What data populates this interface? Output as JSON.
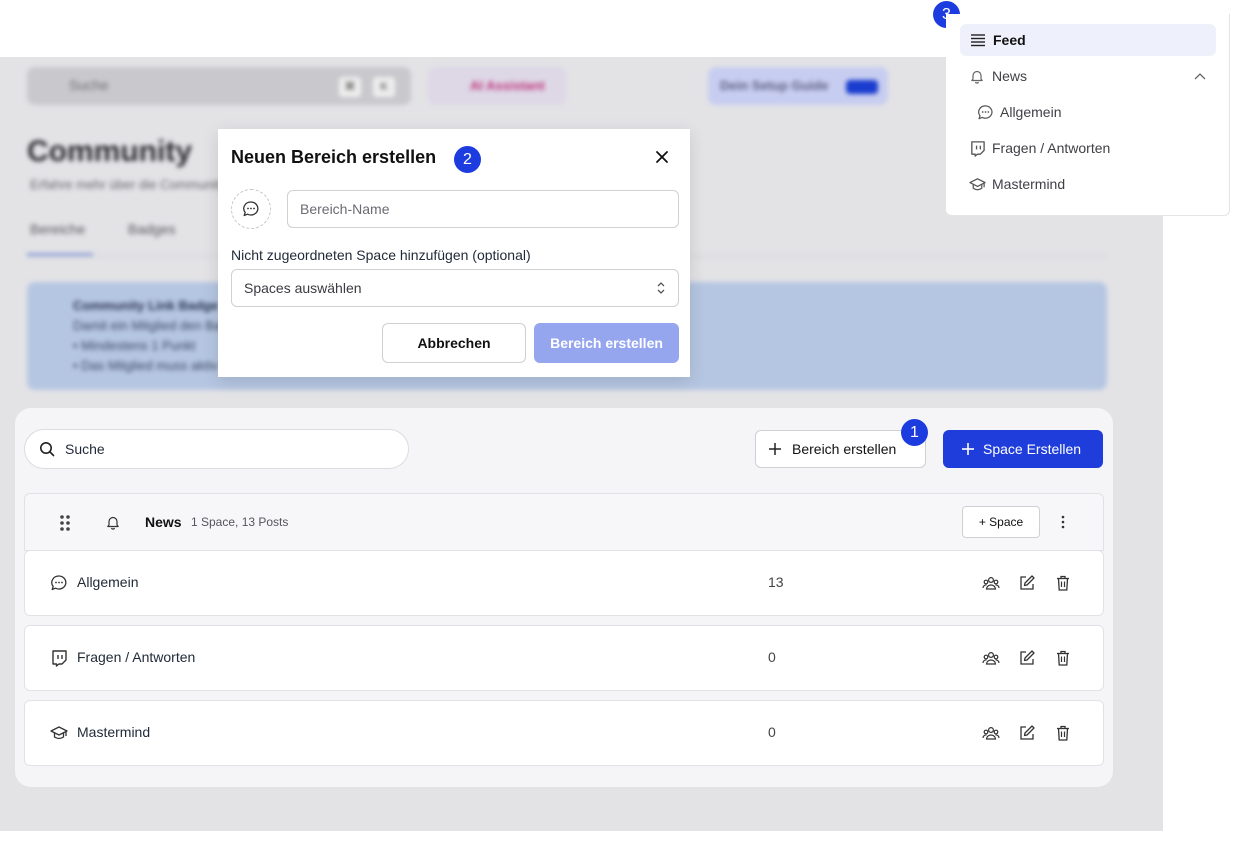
{
  "background": {
    "search_placeholder": "Suche",
    "shortcut_keys": [
      "⌘",
      "K"
    ],
    "ai_assistant_label": "AI Assistant",
    "setup_guide_label": "Dein Setup Guide",
    "page_title": "Community",
    "page_subtitle": "Erfahre mehr über die Community",
    "tabs": [
      "Bereiche",
      "Badges"
    ],
    "info_title": "Community Link Badge",
    "info_text": "Damit ein Mitglied den Badge erhält, muss",
    "info_bullets": [
      "Mindestens 1 Punkt",
      "Das Mitglied muss aktiv sein"
    ]
  },
  "toolbar": {
    "search_label": "Suche",
    "create_area_label": "Bereich erstellen",
    "create_space_label": "Space Erstellen"
  },
  "badges": {
    "one": "1",
    "two": "2",
    "three": "3"
  },
  "group": {
    "name": "News",
    "meta": "1 Space, 13 Posts",
    "add_space_label": "+ Space"
  },
  "rows": [
    {
      "name": "Allgemein",
      "count": "13",
      "icon": "chat-bubble-icon"
    },
    {
      "name": "Fragen / Antworten",
      "count": "0",
      "icon": "twitch-icon"
    },
    {
      "name": "Mastermind",
      "count": "0",
      "icon": "graduation-cap-icon"
    }
  ],
  "modal": {
    "title": "Neuen Bereich erstellen",
    "name_placeholder": "Bereich-Name",
    "field_label": "Nicht zugeordneten Space hinzufügen (optional)",
    "select_placeholder": "Spaces auswählen",
    "cancel_label": "Abbrechen",
    "create_label": "Bereich erstellen"
  },
  "nav_panel": {
    "feed_label": "Feed",
    "news_label": "News",
    "allgemein_label": "Allgemein",
    "fragen_label": "Fragen / Antworten",
    "mastermind_label": "Mastermind"
  },
  "colors": {
    "primary": "#1f3ddb",
    "badge": "#1d3ce0",
    "disabled_primary": "#95a6ef"
  }
}
